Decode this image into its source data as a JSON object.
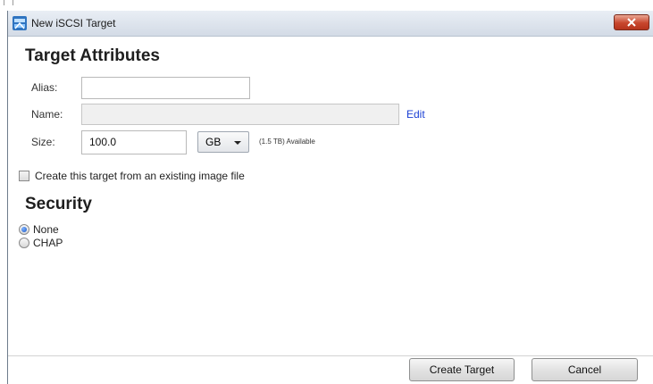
{
  "window": {
    "title": "New iSCSI Target",
    "close_icon": "close-icon"
  },
  "target_attributes": {
    "heading": "Target Attributes",
    "alias_label": "Alias:",
    "alias_value": "",
    "name_label": "Name:",
    "name_value": "",
    "edit_link": "Edit",
    "size_label": "Size:",
    "size_value": "100.0",
    "size_unit": "GB",
    "available_text": "(1.5 TB) Available",
    "from_image_checkbox_label": "Create this target from an existing image file",
    "from_image_checked": false
  },
  "security": {
    "heading": "Security",
    "options": [
      {
        "label": "None",
        "selected": true
      },
      {
        "label": "CHAP",
        "selected": false
      }
    ]
  },
  "buttons": {
    "create": "Create Target",
    "cancel": "Cancel"
  },
  "colors": {
    "link": "#1a3fd4",
    "radio_selected": "#1a56c4",
    "close_button": "#c8462d"
  }
}
